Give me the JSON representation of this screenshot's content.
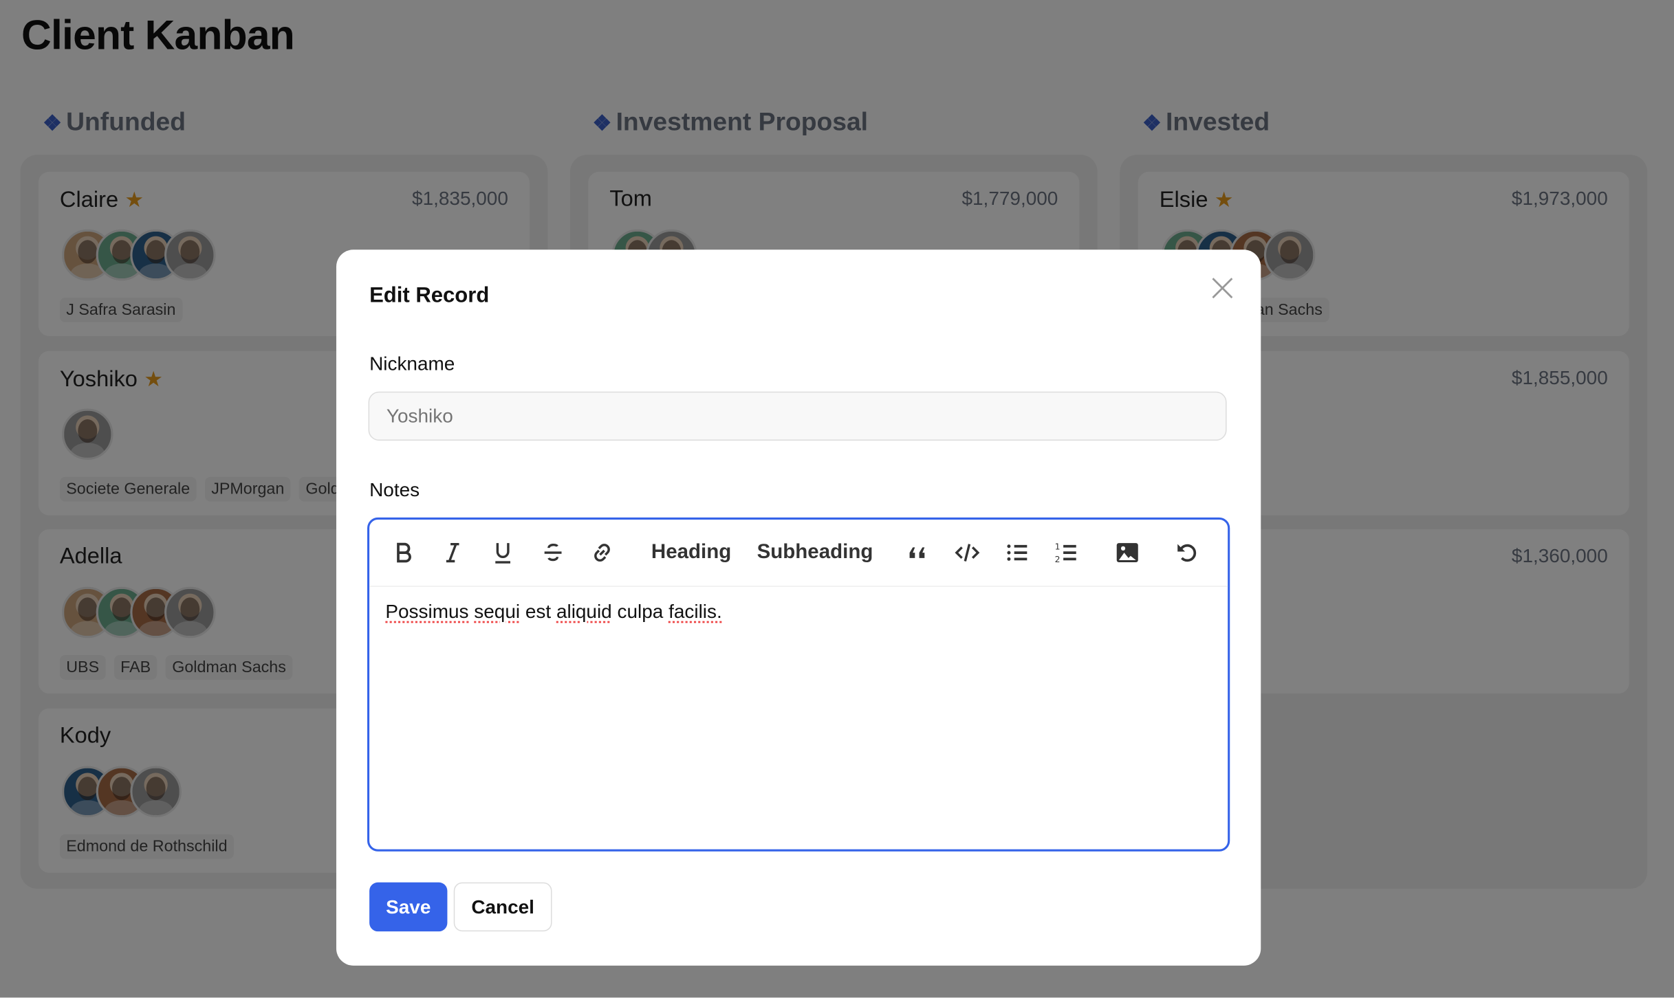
{
  "page": {
    "title": "Client Kanban"
  },
  "columns": [
    {
      "title": "Unfunded",
      "cards": [
        {
          "name": "Claire",
          "starred": true,
          "amount": "$1,835,000",
          "avatars": [
            "#c9a27a",
            "#6aa98c",
            "#2d5f8a",
            "#9a9a9a"
          ],
          "tags": [
            "J Safra Sarasin"
          ]
        },
        {
          "name": "Yoshiko",
          "starred": true,
          "amount": "",
          "avatars": [
            "#9a9a9a"
          ],
          "tags": [
            "Societe Generale",
            "JPMorgan",
            "Goldman Sachs"
          ]
        },
        {
          "name": "Adella",
          "starred": false,
          "amount": "",
          "avatars": [
            "#c9a27a",
            "#6aa98c",
            "#a56a45",
            "#9a9a9a"
          ],
          "tags": [
            "UBS",
            "FAB",
            "Goldman Sachs"
          ]
        },
        {
          "name": "Kody",
          "starred": false,
          "amount": "",
          "avatars": [
            "#2d5f8a",
            "#a56a45",
            "#9a9a9a"
          ],
          "tags": [
            "Edmond de Rothschild"
          ]
        }
      ]
    },
    {
      "title": "Investment Proposal",
      "cards": [
        {
          "name": "Tom",
          "starred": false,
          "amount": "$1,779,000",
          "avatars": [
            "#6aa98c",
            "#9a9a9a"
          ],
          "tags": []
        }
      ]
    },
    {
      "title": "Invested",
      "cards": [
        {
          "name": "Elsie",
          "starred": true,
          "amount": "$1,973,000",
          "avatars": [
            "#6aa98c",
            "#2d5f8a",
            "#a56a45",
            "#9a9a9a"
          ],
          "tags": [
            "Goldman Sachs"
          ]
        },
        {
          "name": "",
          "starred": false,
          "amount": "$1,855,000",
          "avatars": [],
          "tags": []
        },
        {
          "name": "",
          "starred": false,
          "amount": "$1,360,000",
          "avatars": [],
          "tags": []
        }
      ]
    }
  ],
  "modal": {
    "title": "Edit Record",
    "nickname_label": "Nickname",
    "nickname_placeholder": "Yoshiko",
    "notes_label": "Notes",
    "toolbar": {
      "heading": "Heading",
      "subheading": "Subheading"
    },
    "notes_content": [
      "Possimus",
      "sequi",
      "est",
      "aliquid",
      "culpa",
      "facilis."
    ],
    "save_label": "Save",
    "cancel_label": "Cancel"
  },
  "colors": {
    "accent": "#3563e9",
    "star": "#e39a1c",
    "column_icon": "#3b5fc4"
  }
}
